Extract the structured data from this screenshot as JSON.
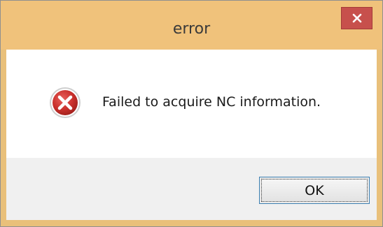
{
  "window": {
    "title": "error"
  },
  "dialog": {
    "message": "Failed to acquire NC information.",
    "icon": "error-x-icon"
  },
  "buttons": {
    "ok_label": "OK",
    "close_icon": "close-icon"
  },
  "colors": {
    "titlebar": "#f0c27b",
    "close_button": "#c7504c",
    "button_area": "#f0f0f0",
    "error_icon": "#c9302c"
  }
}
